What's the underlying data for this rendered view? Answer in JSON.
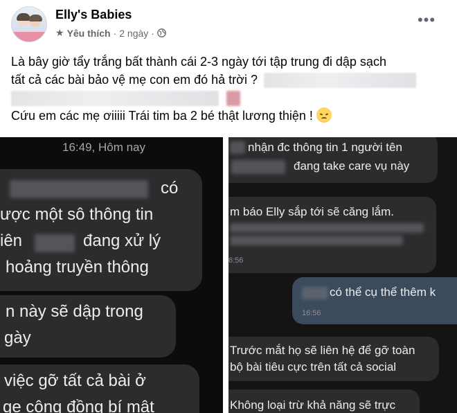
{
  "post": {
    "page_name": "Elly's Babies",
    "favorite_label": "Yêu thích",
    "separator": "·",
    "time_ago": "2 ngày",
    "separator2": "·",
    "more_icon": "more-horizontal-icon"
  },
  "body": {
    "line1": "Là bây giờ tẩy trắng bất thành cái 2-3 ngày tới tập trung đi dập sạch",
    "line2": "tất cả các bài bảo vệ mẹ con em đó hả trời ?",
    "line4": "Cứu em các mẹ ơiiiii Trái tim ba 2 bé thật lương thiện !"
  },
  "chat_left": {
    "time_header": "16:49, Hôm nay",
    "b1_l1": "có",
    "b1_l2": "ược một sô thông tin",
    "b1_l3a": "iên",
    "b1_l3b": "đang xử lý",
    "b1_l4": "hoảng truyền thông",
    "b2_l1": "n này sẽ dập trong",
    "b2_l2": "gày",
    "b3_l1": "việc gỡ tất cả bài ở",
    "b3_l2": "ge cộng đồng bí mật"
  },
  "chat_right": {
    "b1_l1": "nhận đc thông tin 1 người tên",
    "b1_l2": "đang take care vụ này",
    "b2_l1": "m báo Elly sắp tới sẽ căng lắm.",
    "b2_time": "6:56",
    "sent_text": "có thể cụ thể thêm k",
    "sent_time": "16:56",
    "b3_l1": "Trước mắt họ sẽ liên hệ để gỡ toàn",
    "b3_l2": "bộ bài tiêu cực trên tất cả social",
    "b4_l1": "Không loại trừ khả năng sẽ trực"
  }
}
